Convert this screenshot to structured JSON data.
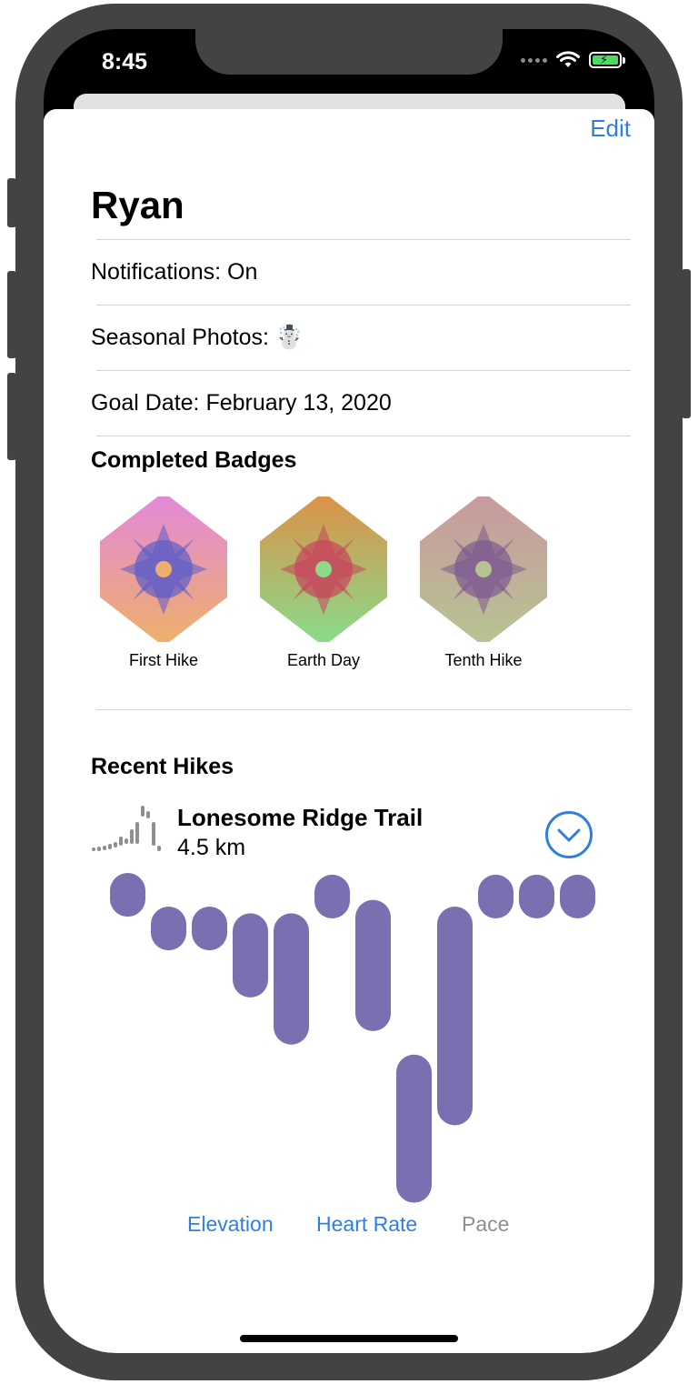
{
  "status_bar": {
    "time": "8:45"
  },
  "profile": {
    "edit_label": "Edit",
    "name": "Ryan",
    "notifications": "Notifications: On",
    "seasonal_photos": "Seasonal Photos: ☃️",
    "goal_date": "Goal Date: February 13, 2020"
  },
  "badges": {
    "title": "Completed Badges",
    "items": [
      {
        "label": "First Hike",
        "color_top": "#e38ad6",
        "color_bottom": "#eeae6e",
        "center": "#5c5cc8"
      },
      {
        "label": "Earth Day",
        "color_top": "#d8944a",
        "color_bottom": "#8cd98a",
        "center": "#c8455c"
      },
      {
        "label": "Tenth Hike",
        "color_top": "#c89a9e",
        "color_bottom": "#b8c292",
        "center": "#7c5a90"
      }
    ]
  },
  "recent_hikes": {
    "title": "Recent Hikes",
    "hike": {
      "name": "Lonesome Ridge Trail",
      "distance": "4.5 km"
    },
    "tabs": [
      {
        "label": "Elevation",
        "state": "active"
      },
      {
        "label": "Heart Rate",
        "state": "active"
      },
      {
        "label": "Pace",
        "state": "inactive"
      }
    ]
  },
  "chart_data": {
    "type": "bar",
    "bar_color": "#7870b0",
    "note_ranges": "floating range bars; values are relative position (0 = top, 1 = bottom of chart area)",
    "ranges": [
      [
        0.0,
        0.13
      ],
      [
        0.1,
        0.23
      ],
      [
        0.1,
        0.23
      ],
      [
        0.12,
        0.37
      ],
      [
        0.12,
        0.51
      ],
      [
        0.005,
        0.135
      ],
      [
        0.08,
        0.47
      ],
      [
        0.54,
        0.98
      ],
      [
        0.1,
        0.75
      ],
      [
        0.005,
        0.135
      ],
      [
        0.005,
        0.135
      ],
      [
        0.005,
        0.135
      ]
    ]
  },
  "colors": {
    "accent": "#2f7fe0",
    "frame": "#434343"
  }
}
